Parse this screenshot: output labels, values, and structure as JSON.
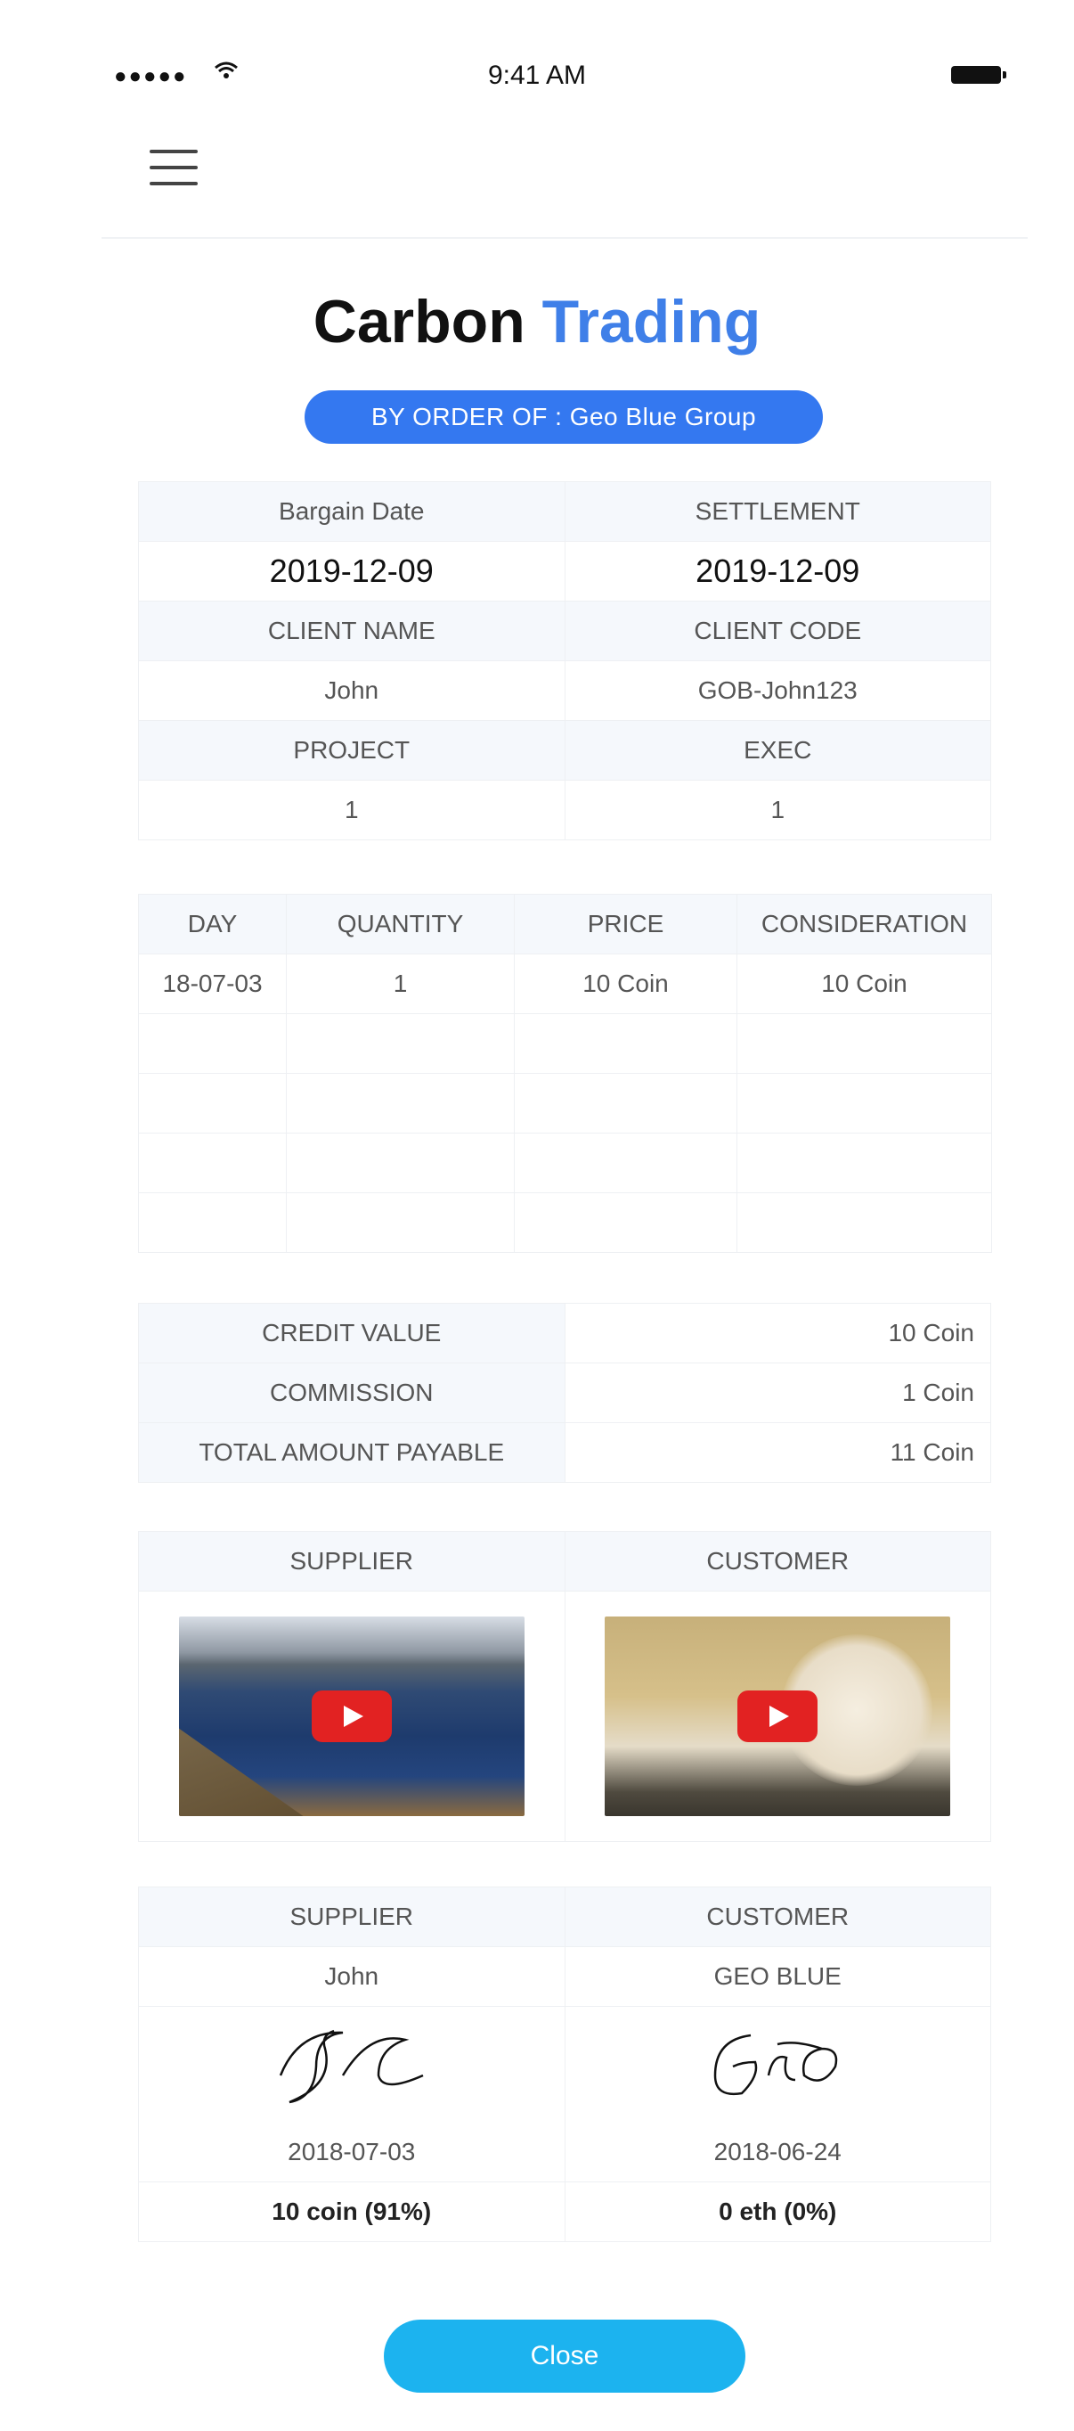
{
  "status_bar": {
    "signal": "●●●●●",
    "time": "9:41 AM"
  },
  "header": {
    "title_part1": "Carbon",
    "title_part2": "Trading",
    "badge": "BY ORDER OF : Geo Blue Group"
  },
  "info": {
    "bargain_date_label": "Bargain Date",
    "settlement_label": "SETTLEMENT",
    "bargain_date": "2019-12-09",
    "settlement": "2019-12-09",
    "client_name_label": "CLIENT NAME",
    "client_code_label": "CLIENT CODE",
    "client_name": "John",
    "client_code": "GOB-John123",
    "project_label": "PROJECT",
    "exec_label": "EXEC",
    "project": "1",
    "exec": "1"
  },
  "trades": {
    "headers": [
      "DAY",
      "QUANTITY",
      "PRICE",
      "CONSIDERATION"
    ],
    "rows": [
      [
        "18-07-03",
        "1",
        "10 Coin",
        "10 Coin"
      ]
    ]
  },
  "summary": {
    "credit_value_label": "CREDIT VALUE",
    "credit_value": "10 Coin",
    "commission_label": "COMMISSION",
    "commission": "1 Coin",
    "total_label": "TOTAL AMOUNT PAYABLE",
    "total": "11 Coin"
  },
  "videos": {
    "supplier_label": "SUPPLIER",
    "customer_label": "CUSTOMER"
  },
  "parties": {
    "supplier_label": "SUPPLIER",
    "customer_label": "CUSTOMER",
    "supplier_name": "John",
    "customer_name": "GEO BLUE",
    "supplier_date": "2018-07-03",
    "customer_date": "2018-06-24",
    "supplier_amount": "10 coin (91%)",
    "customer_amount": "0 eth (0%)"
  },
  "close_label": "Close"
}
